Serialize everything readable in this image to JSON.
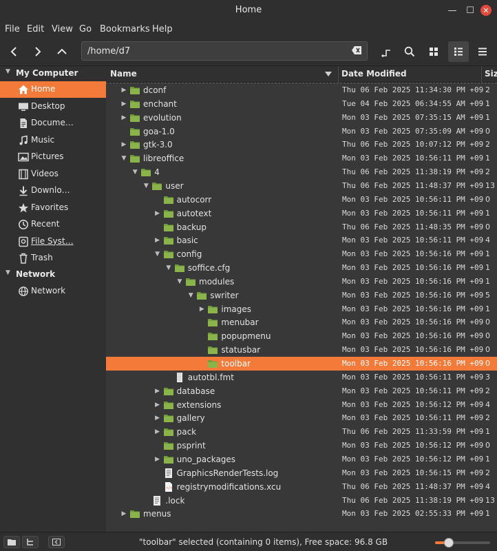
{
  "window": {
    "title": "Home"
  },
  "menu": [
    "File",
    "Edit",
    "View",
    "Go",
    "Bookmarks",
    "Help"
  ],
  "location": {
    "path": "/home/d7"
  },
  "sidebar": {
    "my_computer": "My Computer",
    "items": [
      {
        "label": "Home",
        "icon": "home-icon",
        "selected": true
      },
      {
        "label": "Desktop",
        "icon": "desktop-icon"
      },
      {
        "label": "Docume…",
        "icon": "documents-icon"
      },
      {
        "label": "Music",
        "icon": "music-icon"
      },
      {
        "label": "Pictures",
        "icon": "pictures-icon"
      },
      {
        "label": "Videos",
        "icon": "videos-icon"
      },
      {
        "label": "Downlo…",
        "icon": "downloads-icon"
      },
      {
        "label": "Favorites",
        "icon": "star-icon"
      },
      {
        "label": "Recent",
        "icon": "clock-icon"
      },
      {
        "label": "File Syst…",
        "icon": "drive-icon"
      },
      {
        "label": "Trash",
        "icon": "trash-icon"
      }
    ],
    "network": "Network",
    "network_items": [
      {
        "label": "Network",
        "icon": "network-icon"
      }
    ]
  },
  "columns": {
    "name": "Name",
    "date": "Date Modified",
    "size": "Siz"
  },
  "files": [
    {
      "name": "dconf",
      "depth": 0,
      "type": "folder",
      "expander": "closed",
      "date": "Thu 06 Feb 2025 11:34:30 PM +09",
      "size": "2"
    },
    {
      "name": "enchant",
      "depth": 0,
      "type": "folder",
      "expander": "closed",
      "date": "Tue 04 Feb 2025 06:34:55 AM +09",
      "size": "1"
    },
    {
      "name": "evolution",
      "depth": 0,
      "type": "folder",
      "expander": "closed",
      "date": "Mon 03 Feb 2025 07:35:15 AM +09",
      "size": "1"
    },
    {
      "name": "goa-1.0",
      "depth": 0,
      "type": "folder",
      "expander": "none",
      "date": "Mon 03 Feb 2025 07:35:09 AM +09",
      "size": "0"
    },
    {
      "name": "gtk-3.0",
      "depth": 0,
      "type": "folder",
      "expander": "closed",
      "date": "Thu 06 Feb 2025 10:07:12 PM +09",
      "size": "2"
    },
    {
      "name": "libreoffice",
      "depth": 0,
      "type": "folder",
      "expander": "open",
      "date": "Mon 03 Feb 2025 10:56:11 PM +09",
      "size": "1"
    },
    {
      "name": "4",
      "depth": 1,
      "type": "folder",
      "expander": "open",
      "date": "Thu 06 Feb 2025 11:38:19 PM +09",
      "size": "2"
    },
    {
      "name": "user",
      "depth": 2,
      "type": "folder",
      "expander": "open",
      "date": "Thu 06 Feb 2025 11:48:37 PM +09",
      "size": "13"
    },
    {
      "name": "autocorr",
      "depth": 3,
      "type": "folder",
      "expander": "none",
      "date": "Mon 03 Feb 2025 10:56:11 PM +09",
      "size": "0"
    },
    {
      "name": "autotext",
      "depth": 3,
      "type": "folder",
      "expander": "closed",
      "date": "Mon 03 Feb 2025 10:56:11 PM +09",
      "size": "1"
    },
    {
      "name": "backup",
      "depth": 3,
      "type": "folder",
      "expander": "none",
      "date": "Thu 06 Feb 2025 11:48:35 PM +09",
      "size": "0"
    },
    {
      "name": "basic",
      "depth": 3,
      "type": "folder",
      "expander": "closed",
      "date": "Mon 03 Feb 2025 10:56:11 PM +09",
      "size": "4"
    },
    {
      "name": "config",
      "depth": 3,
      "type": "folder",
      "expander": "open",
      "date": "Mon 03 Feb 2025 10:56:16 PM +09",
      "size": "1"
    },
    {
      "name": "soffice.cfg",
      "depth": 4,
      "type": "folder",
      "expander": "open",
      "date": "Mon 03 Feb 2025 10:56:16 PM +09",
      "size": "1"
    },
    {
      "name": "modules",
      "depth": 5,
      "type": "folder",
      "expander": "open",
      "date": "Mon 03 Feb 2025 10:56:16 PM +09",
      "size": "1"
    },
    {
      "name": "swriter",
      "depth": 6,
      "type": "folder",
      "expander": "open",
      "date": "Mon 03 Feb 2025 10:56:16 PM +09",
      "size": "5"
    },
    {
      "name": "images",
      "depth": 7,
      "type": "folder",
      "expander": "closed",
      "date": "Mon 03 Feb 2025 10:56:16 PM +09",
      "size": "1"
    },
    {
      "name": "menubar",
      "depth": 7,
      "type": "folder",
      "expander": "none",
      "date": "Mon 03 Feb 2025 10:56:16 PM +09",
      "size": "0"
    },
    {
      "name": "popupmenu",
      "depth": 7,
      "type": "folder",
      "expander": "none",
      "date": "Mon 03 Feb 2025 10:56:16 PM +09",
      "size": "0"
    },
    {
      "name": "statusbar",
      "depth": 7,
      "type": "folder",
      "expander": "none",
      "date": "Mon 03 Feb 2025 10:56:16 PM +09",
      "size": "0"
    },
    {
      "name": "toolbar",
      "depth": 7,
      "type": "folder",
      "expander": "none",
      "date": "Mon 03 Feb 2025 10:56:16 PM +09",
      "size": "0",
      "selected": true
    },
    {
      "name": "autotbl.fmt",
      "depth": 4,
      "type": "file-generic",
      "expander": "none",
      "date": "Mon 03 Feb 2025 10:56:11 PM +09",
      "size": "3"
    },
    {
      "name": "database",
      "depth": 3,
      "type": "folder",
      "expander": "closed",
      "date": "Mon 03 Feb 2025 10:56:11 PM +09",
      "size": "2"
    },
    {
      "name": "extensions",
      "depth": 3,
      "type": "folder",
      "expander": "closed",
      "date": "Mon 03 Feb 2025 10:56:12 PM +09",
      "size": "4"
    },
    {
      "name": "gallery",
      "depth": 3,
      "type": "folder",
      "expander": "closed",
      "date": "Mon 03 Feb 2025 10:56:11 PM +09",
      "size": "2"
    },
    {
      "name": "pack",
      "depth": 3,
      "type": "folder",
      "expander": "closed",
      "date": "Thu 06 Feb 2025 11:33:59 PM +09",
      "size": "1"
    },
    {
      "name": "psprint",
      "depth": 3,
      "type": "folder",
      "expander": "none",
      "date": "Mon 03 Feb 2025 10:56:12 PM +09",
      "size": "0"
    },
    {
      "name": "uno_packages",
      "depth": 3,
      "type": "folder",
      "expander": "closed",
      "date": "Mon 03 Feb 2025 10:56:12 PM +09",
      "size": "1"
    },
    {
      "name": "GraphicsRenderTests.log",
      "depth": 3,
      "type": "file-text",
      "expander": "none",
      "date": "Mon 03 Feb 2025 10:56:15 PM +09",
      "size": "2"
    },
    {
      "name": "registrymodifications.xcu",
      "depth": 3,
      "type": "file-xml",
      "expander": "none",
      "date": "Thu 06 Feb 2025 11:48:37 PM +09",
      "size": "4"
    },
    {
      "name": ".lock",
      "depth": 2,
      "type": "file-text",
      "expander": "none",
      "date": "Thu 06 Feb 2025 11:38:19 PM +09",
      "size": "13"
    },
    {
      "name": "menus",
      "depth": 0,
      "type": "folder",
      "expander": "closed",
      "date": "Mon 03 Feb 2025 02:55:33 PM +09",
      "size": "1"
    }
  ],
  "status": {
    "text": "\"toolbar\" selected (containing 0 items), Free space: 96.8 GB",
    "zoom": 0.25
  },
  "colors": {
    "accent": "#f47a3a",
    "folder": "#8ab34a",
    "folder_dark": "#6e9a3a"
  }
}
